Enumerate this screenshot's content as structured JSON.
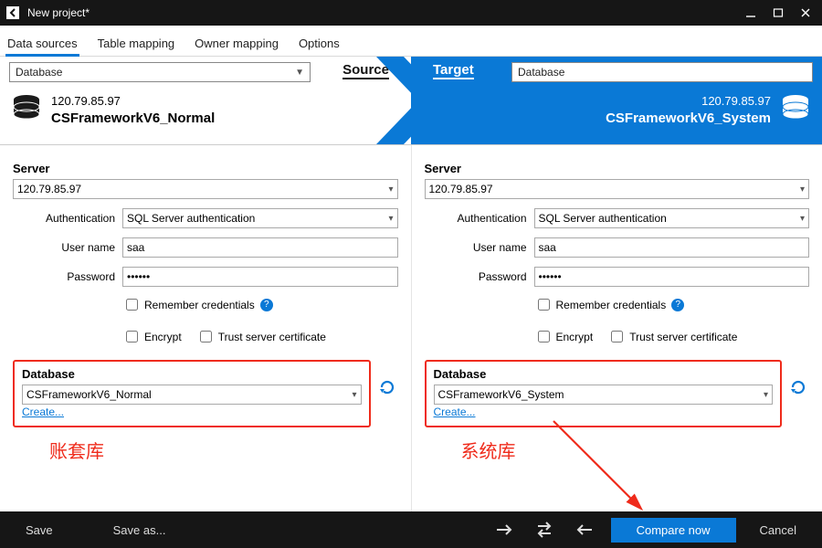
{
  "window": {
    "title": "New project*"
  },
  "tabs": {
    "data_sources": "Data sources",
    "table_mapping": "Table mapping",
    "owner_mapping": "Owner mapping",
    "options": "Options"
  },
  "band": {
    "source_label": "Source",
    "target_label": "Target",
    "type_label": "Database",
    "source": {
      "server": "120.79.85.97",
      "db": "CSFrameworkV6_Normal"
    },
    "target": {
      "server": "120.79.85.97",
      "db": "CSFrameworkV6_System"
    }
  },
  "form": {
    "server_heading": "Server",
    "auth_label": "Authentication",
    "user_label": "User name",
    "pass_label": "Password",
    "remember_label": "Remember credentials",
    "encrypt_label": "Encrypt",
    "trust_label": "Trust server certificate",
    "db_heading": "Database",
    "create_link": "Create...",
    "auth_mode": "SQL Server authentication",
    "user_value": "saa",
    "pass_mask": "••••••",
    "source_db": "CSFrameworkV6_Normal",
    "target_db": "CSFrameworkV6_System",
    "source_note": "账套库",
    "target_note": "系统库",
    "source_server": "120.79.85.97",
    "target_server": "120.79.85.97"
  },
  "bottom": {
    "save": "Save",
    "save_as": "Save as...",
    "compare": "Compare now",
    "cancel": "Cancel"
  }
}
